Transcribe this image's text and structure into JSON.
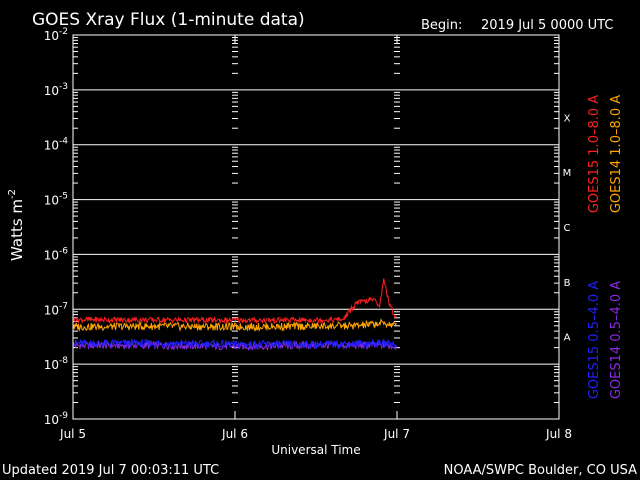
{
  "chart_data": {
    "type": "line",
    "title": "GOES Xray Flux (1-minute data)",
    "begin_label": "Begin:",
    "begin_value": "2019 Jul 5 0000 UTC",
    "xlabel": "Universal Time",
    "ylabel": "Watts m",
    "ylabel_sup": "-2",
    "updated": "Updated 2019 Jul  7 00:03:11 UTC",
    "credit": "NOAA/SWPC Boulder, CO USA",
    "y_scale": "log",
    "ylim": [
      1e-09,
      0.01
    ],
    "y_ticks": [
      {
        "base": "10",
        "exp": "-2"
      },
      {
        "base": "10",
        "exp": "-3"
      },
      {
        "base": "10",
        "exp": "-4"
      },
      {
        "base": "10",
        "exp": "-5"
      },
      {
        "base": "10",
        "exp": "-6"
      },
      {
        "base": "10",
        "exp": "-7"
      },
      {
        "base": "10",
        "exp": "-8"
      },
      {
        "base": "10",
        "exp": "-9"
      }
    ],
    "x_ticks": [
      "Jul 5",
      "Jul 6",
      "Jul 7",
      "Jul 8"
    ],
    "flare_classes": [
      "X",
      "M",
      "C",
      "B",
      "A"
    ],
    "grid": true,
    "series": [
      {
        "name": "GOES15 1.0–8.0 A",
        "color": "#ff2020",
        "x": [
          "Jul 5 00:00",
          "Jul 5 12:00",
          "Jul 6 00:00",
          "Jul 6 12:00",
          "Jul 6 16:00",
          "Jul 6 18:00",
          "Jul 6 20:30",
          "Jul 6 21:30",
          "Jul 6 22:00",
          "Jul 6 23:00",
          "Jul 7 00:00"
        ],
        "y": [
          6.5e-08,
          6.4e-08,
          6.3e-08,
          6.4e-08,
          6.5e-08,
          1.3e-07,
          1.5e-07,
          1.2e-07,
          3.6e-07,
          1.1e-07,
          6.6e-08
        ]
      },
      {
        "name": "GOES14 1.0–8.0 A",
        "color": "#ffa500",
        "x": [
          "Jul 5 00:00",
          "Jul 5 12:00",
          "Jul 6 00:00",
          "Jul 6 12:00",
          "Jul 6 18:00",
          "Jul 6 22:00",
          "Jul 7 00:00"
        ],
        "y": [
          4.8e-08,
          4.9e-08,
          4.8e-08,
          4.9e-08,
          5e-08,
          5.6e-08,
          5e-08
        ]
      },
      {
        "name": "GOES15 0.5–4.0 A",
        "color": "#2020ff",
        "x": [
          "Jul 5 00:00",
          "Jul 5 12:00",
          "Jul 6 00:00",
          "Jul 6 12:00",
          "Jul 6 22:00",
          "Jul 7 00:00"
        ],
        "y": [
          2.4e-08,
          2.4e-08,
          2.3e-08,
          2.3e-08,
          2.4e-08,
          2.3e-08
        ]
      },
      {
        "name": "GOES14 0.5–4.0 A",
        "color": "#8a2be2",
        "x": [
          "Jul 5 00:00",
          "Jul 5 12:00",
          "Jul 6 00:00",
          "Jul 6 12:00",
          "Jul 6 22:00",
          "Jul 7 00:00"
        ],
        "y": [
          2.2e-08,
          2.2e-08,
          2.1e-08,
          2.2e-08,
          2.2e-08,
          2.1e-08
        ]
      }
    ]
  }
}
